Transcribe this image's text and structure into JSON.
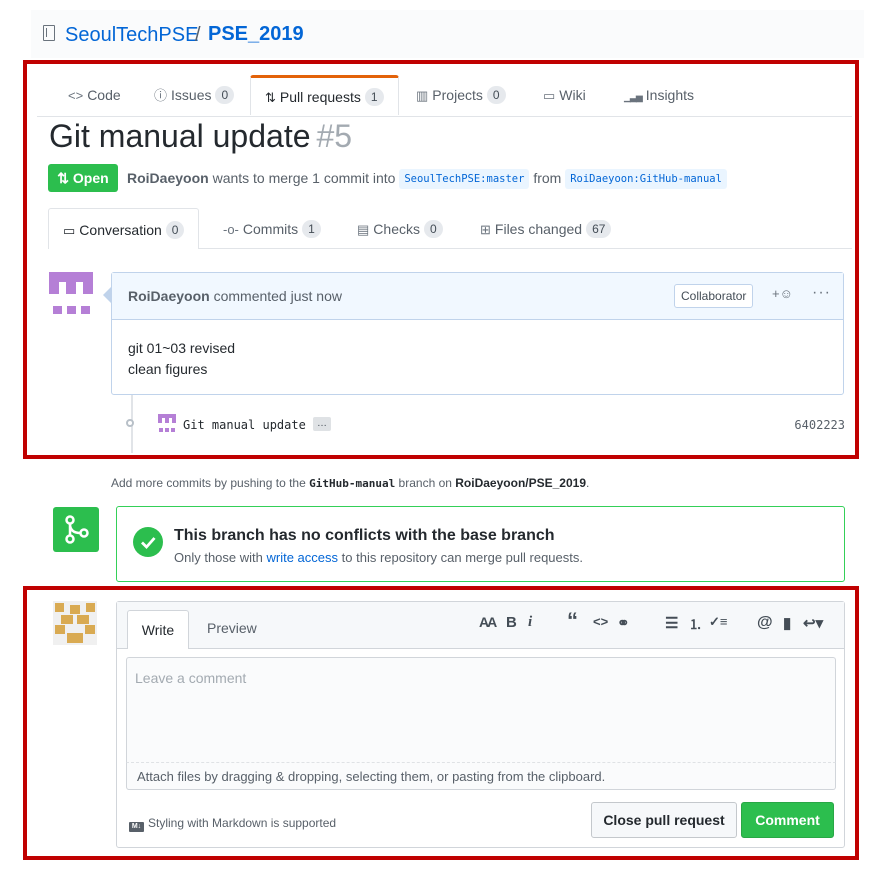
{
  "repo": {
    "owner": "SeoulTechPSE",
    "separator": "/",
    "name": "PSE_2019"
  },
  "repo_nav": [
    {
      "label": "Code",
      "icon": "code-icon",
      "glyph": "<>"
    },
    {
      "label": "Issues",
      "icon": "issue-icon",
      "glyph": "ⓘ",
      "count": "0"
    },
    {
      "label": "Pull requests",
      "icon": "pull-request-icon",
      "glyph": "⇅",
      "count": "1",
      "selected": true
    },
    {
      "label": "Projects",
      "icon": "project-icon",
      "glyph": "▥",
      "count": "0"
    },
    {
      "label": "Wiki",
      "icon": "book-icon",
      "glyph": "▭"
    },
    {
      "label": "Insights",
      "icon": "graph-icon",
      "glyph": "▁▃▅"
    }
  ],
  "pr": {
    "title": "Git manual update",
    "number": "#5",
    "state": "Open",
    "author": "RoiDaeyoon",
    "merge_text": "wants to merge 1 commit into",
    "base_ref": "SeoulTechPSE:master",
    "from_text": "from",
    "head_ref": "RoiDaeyoon:GitHub-manual"
  },
  "pr_tabs": [
    {
      "label": "Conversation",
      "icon": "comment-discussion-icon",
      "count": "0"
    },
    {
      "label": "Commits",
      "icon": "git-commit-icon",
      "count": "1"
    },
    {
      "label": "Checks",
      "icon": "checklist-icon",
      "count": "0"
    },
    {
      "label": "Files changed",
      "icon": "diff-icon",
      "count": "67"
    }
  ],
  "comment": {
    "author": "RoiDaeyoon",
    "action": "commented just now",
    "badge": "Collaborator",
    "reaction_label": "+☺",
    "more_label": "···",
    "body_lines": [
      "git 01~03 revised",
      "clean figures"
    ]
  },
  "commit": {
    "message": "Git manual update",
    "ellipsis": "…",
    "sha": "6402223"
  },
  "note": {
    "prefix": "Add more commits by pushing to the",
    "branch": "GitHub-manual",
    "middle": "branch on",
    "repo": "RoiDaeyoon/PSE_2019",
    "suffix": "."
  },
  "merge": {
    "heading": "This branch has no conflicts with the base branch",
    "sub_prefix": "Only those with",
    "sub_link": "write access",
    "sub_suffix": "to this repository can merge pull requests."
  },
  "form": {
    "write_tab": "Write",
    "preview_tab": "Preview",
    "placeholder": "Leave a comment",
    "attach_text": "Attach files by dragging & dropping, selecting them, or pasting from the clipboard.",
    "markdown_badge": "M↓",
    "markdown_text": "Styling with Markdown is supported",
    "close_button": "Close pull request",
    "comment_button": "Comment",
    "toolbar": [
      {
        "name": "text-size-icon",
        "glyph": "AA"
      },
      {
        "name": "bold-icon",
        "glyph": "B"
      },
      {
        "name": "italic-icon",
        "glyph": "i"
      },
      {
        "name": "quote-icon",
        "glyph": "“"
      },
      {
        "name": "code-icon",
        "glyph": "<>"
      },
      {
        "name": "link-icon",
        "glyph": "⚭"
      },
      {
        "name": "unordered-list-icon",
        "glyph": "☰"
      },
      {
        "name": "ordered-list-icon",
        "glyph": "⒈"
      },
      {
        "name": "task-list-icon",
        "glyph": "✓≡"
      },
      {
        "name": "mention-icon",
        "glyph": "@"
      },
      {
        "name": "bookmark-icon",
        "glyph": "▮"
      },
      {
        "name": "reply-icon",
        "glyph": "↩▾"
      }
    ]
  },
  "colors": {
    "accent_orange": "#e36209",
    "green": "#2cbe4e",
    "link": "#0366d6",
    "highlight_red": "#c00000"
  }
}
